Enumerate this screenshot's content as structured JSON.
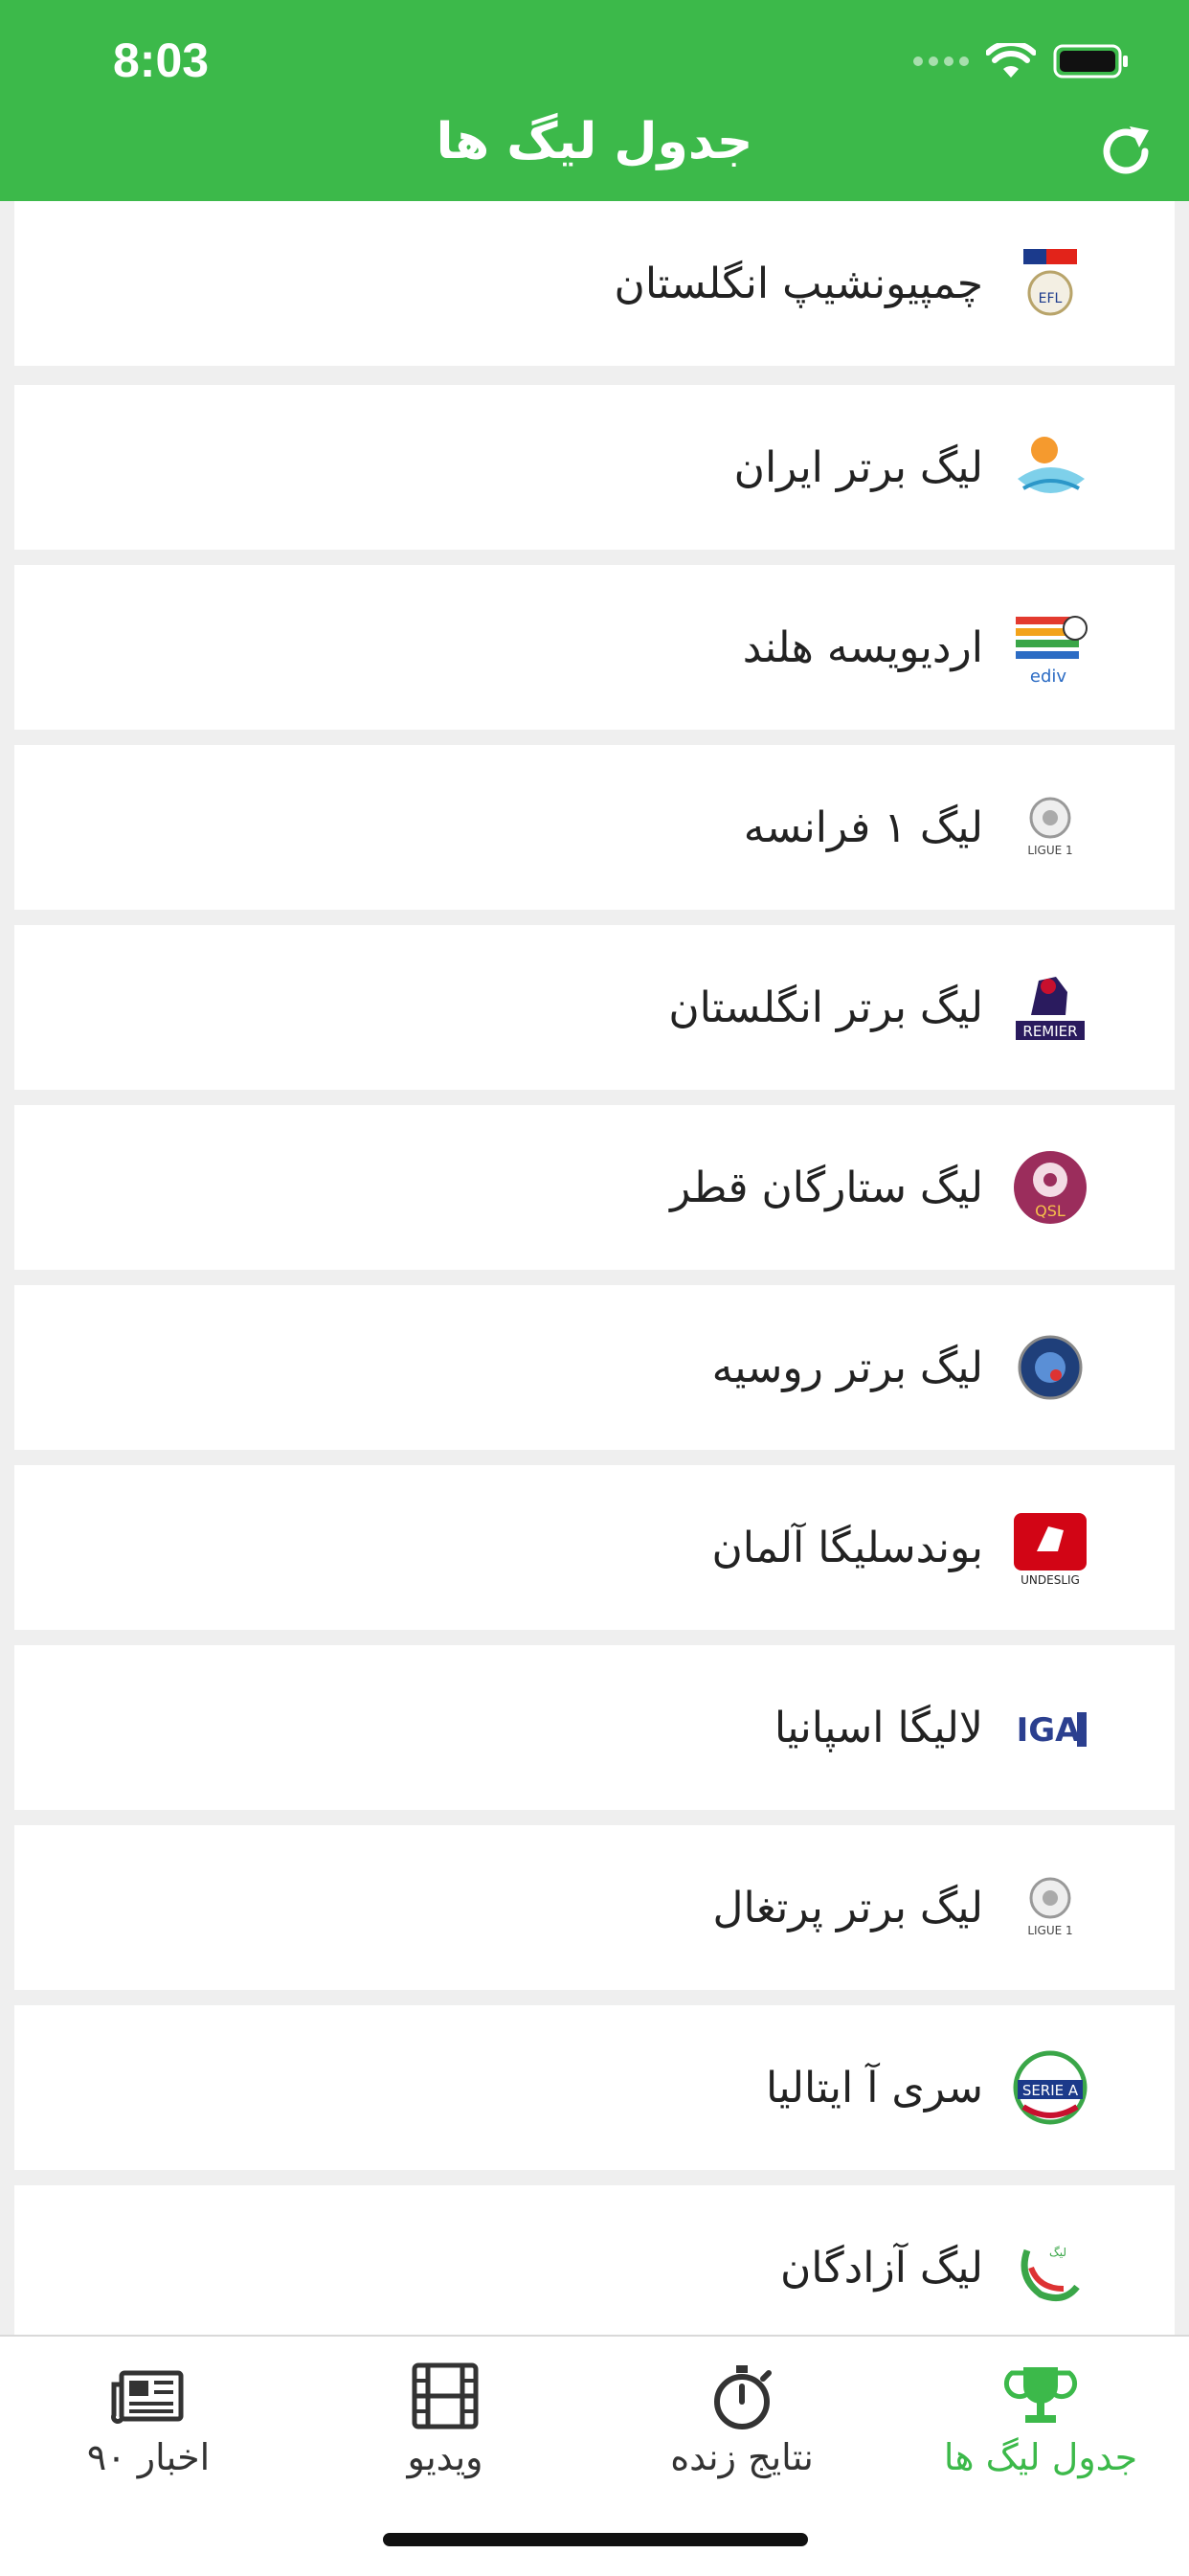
{
  "status_bar": {
    "time": "8:03"
  },
  "header": {
    "title": "جدول لیگ ها",
    "refresh_icon": "refresh-icon",
    "background": "#3cb94a"
  },
  "leagues": [
    {
      "name": "چمپیونشیپ انگلستان",
      "logo_icon": "efl-championship-logo-icon"
    },
    {
      "name": "لیگ برتر ایران",
      "logo_icon": "persian-gulf-league-logo-icon"
    },
    {
      "name": "اردیویسه هلند",
      "logo_icon": "eredivisie-logo-icon"
    },
    {
      "name": "لیگ ۱ فرانسه",
      "logo_icon": "ligue1-logo-icon"
    },
    {
      "name": "لیگ برتر انگلستان",
      "logo_icon": "premier-league-logo-icon"
    },
    {
      "name": "لیگ ستارگان قطر",
      "logo_icon": "qatar-stars-league-logo-icon"
    },
    {
      "name": "لیگ برتر روسیه",
      "logo_icon": "russian-premier-league-logo-icon"
    },
    {
      "name": "بوندسلیگا آلمان",
      "logo_icon": "bundesliga-logo-icon"
    },
    {
      "name": "لالیگا اسپانیا",
      "logo_icon": "laliga-logo-icon"
    },
    {
      "name": "لیگ برتر پرتغال",
      "logo_icon": "liga-portugal-logo-icon"
    },
    {
      "name": "سری آ ایتالیا",
      "logo_icon": "serie-a-logo-icon"
    },
    {
      "name": "لیگ آزادگان",
      "logo_icon": "azadegan-league-logo-icon"
    }
  ],
  "tabbar": {
    "active_color": "#3cb94a",
    "tabs": [
      {
        "label": "جدول لیگ ها",
        "icon": "trophy-icon",
        "active": true
      },
      {
        "label": "نتایج زنده",
        "icon": "stopwatch-icon",
        "active": false
      },
      {
        "label": "ویدیو",
        "icon": "film-icon",
        "active": false
      },
      {
        "label": "اخبار ۹۰",
        "icon": "newspaper-icon",
        "active": false
      }
    ]
  }
}
